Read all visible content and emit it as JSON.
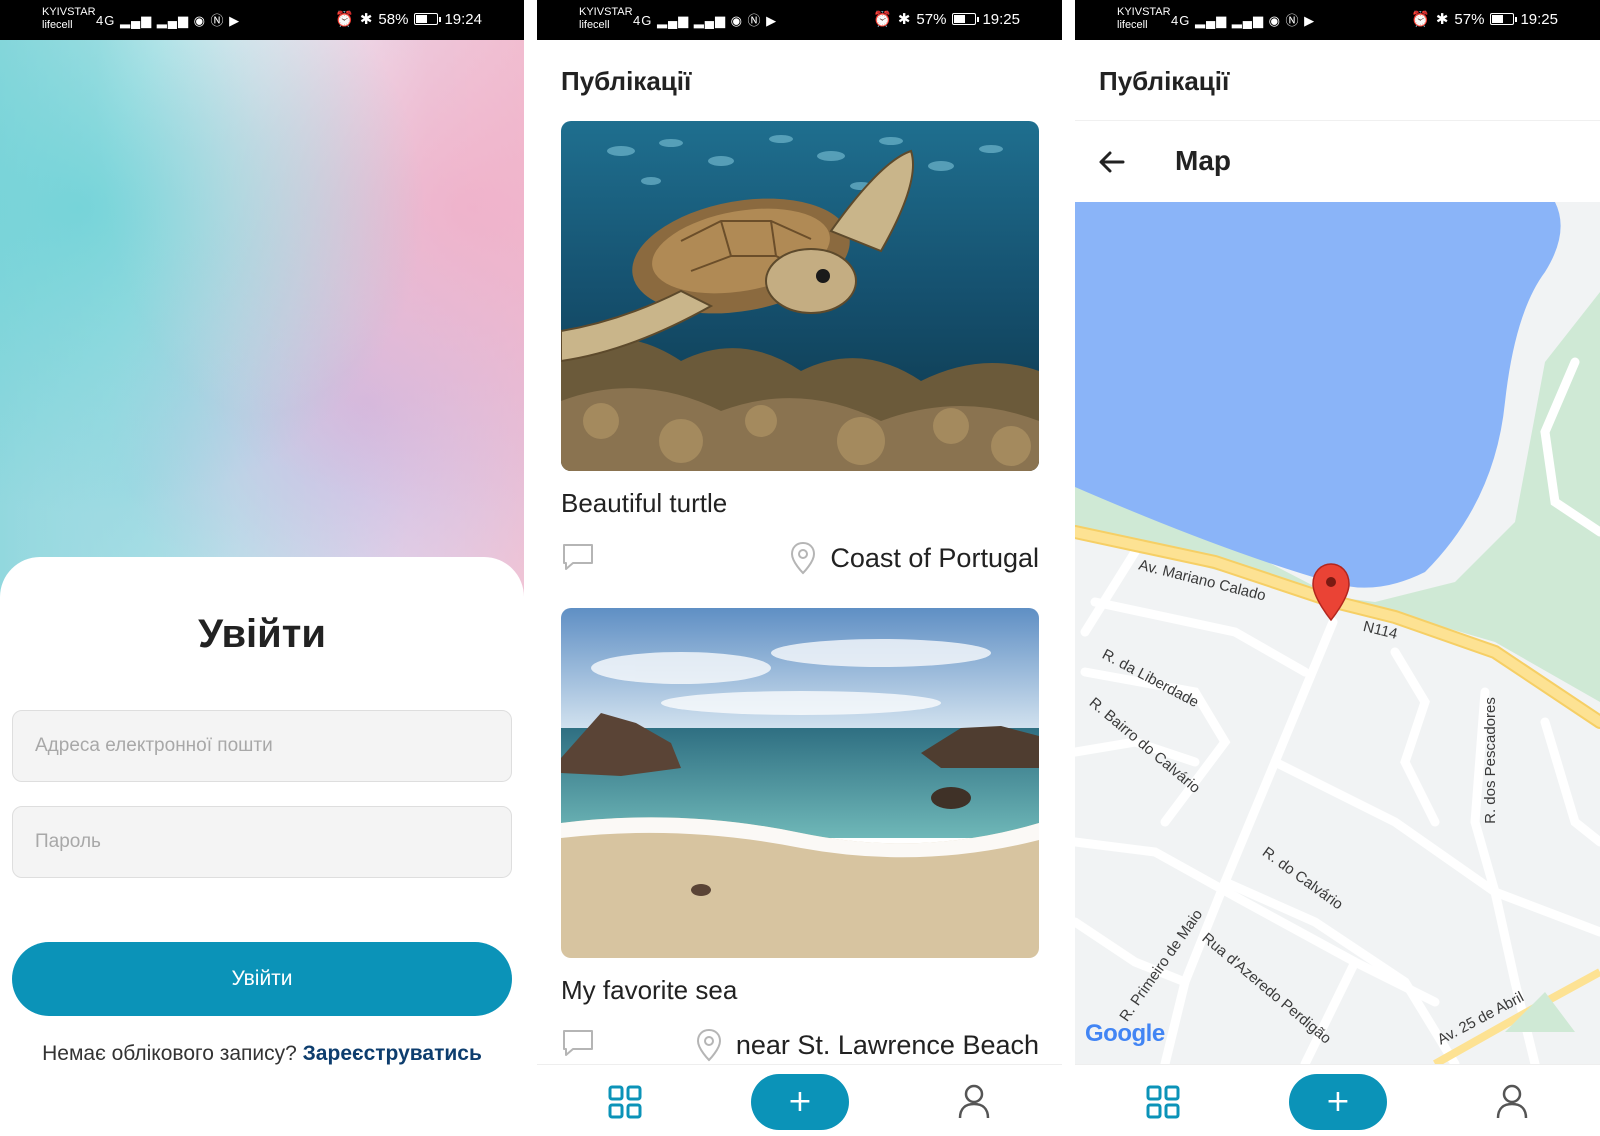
{
  "screens": [
    {
      "status": {
        "carrier1": "KYIVSTAR",
        "carrier2": "lifecell",
        "network": "4G",
        "battery": "58%",
        "battery_level": 0.58,
        "time": "19:24"
      },
      "login": {
        "title": "Увійти",
        "email_placeholder": "Адреса електронної пошти",
        "password_placeholder": "Пароль",
        "submit_label": "Увійти",
        "no_account_text": "Немає облікового запису?",
        "register_link": "Зареєструватись"
      }
    },
    {
      "status": {
        "carrier1": "KYIVSTAR",
        "carrier2": "lifecell",
        "network": "4G",
        "battery": "57%",
        "battery_level": 0.57,
        "time": "19:25"
      },
      "header": {
        "title": "Публікації"
      },
      "posts": [
        {
          "title": "Beautiful turtle",
          "location": "Coast of Portugal",
          "image": "sea-turtle-coral-reef"
        },
        {
          "title": "My favorite sea",
          "location": "near St. Lawrence Beach",
          "image": "rocky-beach-waves"
        }
      ],
      "nav": {
        "add_label": "+",
        "icons": [
          "grid-icon",
          "plus-icon",
          "user-icon"
        ]
      }
    },
    {
      "status": {
        "carrier1": "KYIVSTAR",
        "carrier2": "lifecell",
        "network": "4G",
        "battery": "57%",
        "battery_level": 0.57,
        "time": "19:25"
      },
      "header": {
        "title": "Публікації"
      },
      "map": {
        "title": "Map",
        "streets": [
          "Av. Mariano Calado",
          "N114",
          "R. da Liberdade",
          "R. Bairro do Calvário",
          "R. dos Pescadores",
          "R. do Calvário",
          "R. Primeiro de Maio",
          "Rua d'Azeredo Perdigão",
          "Av. 25 de Abril"
        ],
        "attribution": "Google"
      },
      "nav": {
        "add_label": "+"
      }
    }
  ],
  "colors": {
    "accent": "#0b93b8",
    "link": "#0d3d6e",
    "water": "#8ab4f8",
    "road_major": "#fde293",
    "park": "#cfe9d5",
    "pin": "#ea4335"
  }
}
